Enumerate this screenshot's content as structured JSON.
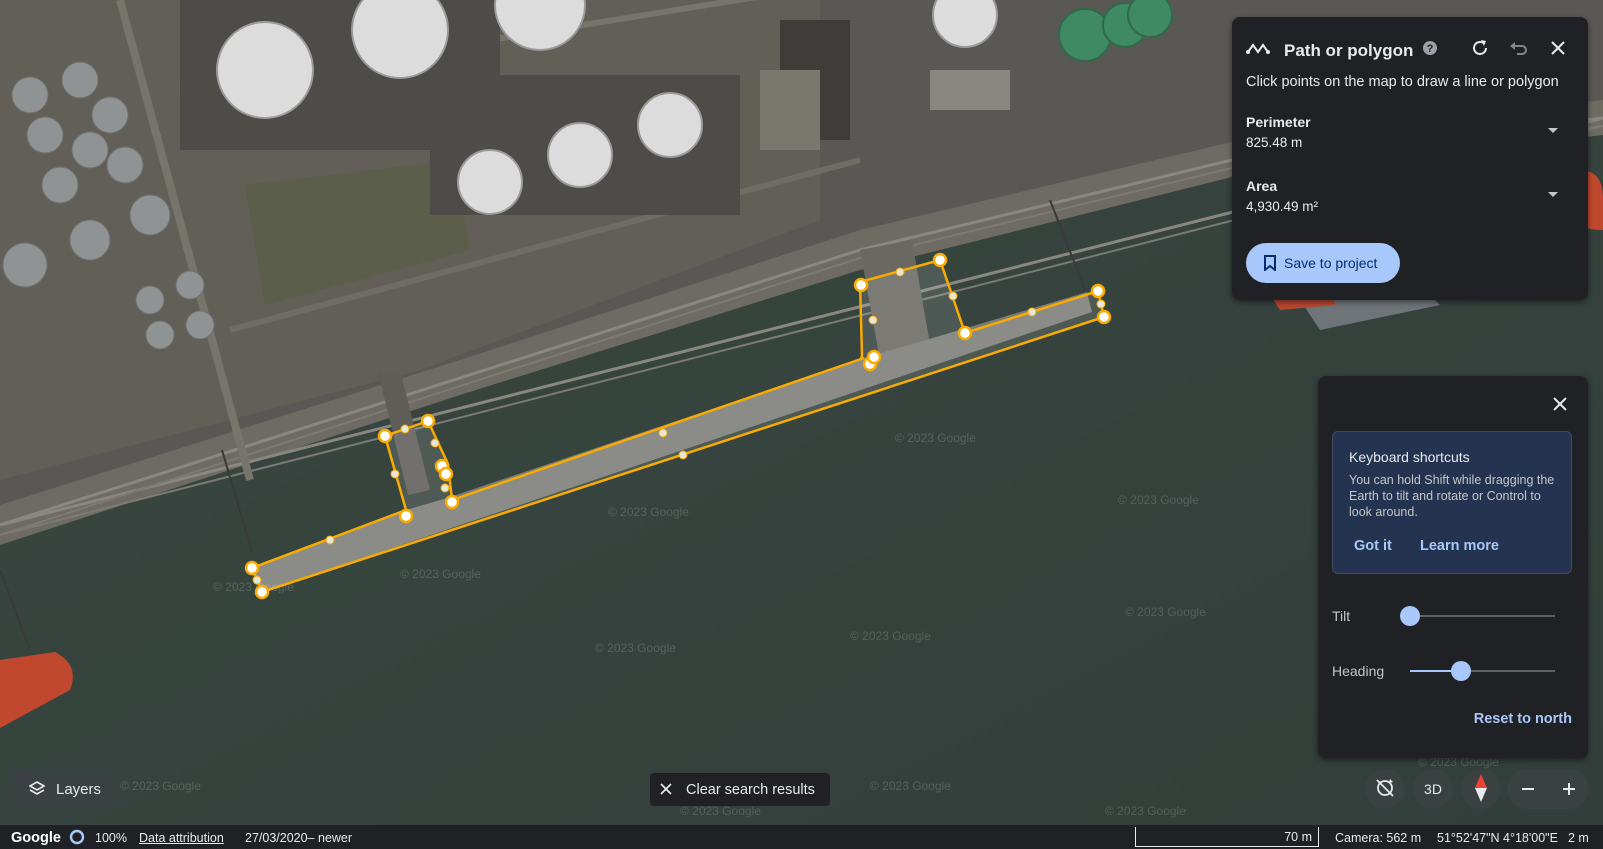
{
  "measure_panel": {
    "title": "Path or polygon",
    "subtitle": "Click points on the map to draw a line or polygon",
    "perimeter_label": "Perimeter",
    "perimeter_value": "825.48 m",
    "area_label": "Area",
    "area_value": "4,930.49 m²",
    "save_label": "Save to project"
  },
  "nav_panel": {
    "shortcuts_title": "Keyboard shortcuts",
    "shortcuts_body": "You can hold Shift while dragging the Earth to tilt and rotate or Control to look around.",
    "got_it": "Got it",
    "learn_more": "Learn more",
    "tilt_label": "Tilt",
    "tilt_value": 0.0,
    "heading_label": "Heading",
    "heading_value": 0.35,
    "reset_label": "Reset to north"
  },
  "controls": {
    "layers_label": "Layers",
    "clear_label": "Clear search results",
    "view_3d_label": "3D"
  },
  "status_bar": {
    "logo": "Google",
    "load_percent": "100%",
    "attribution": "Data attribution",
    "imagery_date": "27/03/2020– newer",
    "scale_label": "70 m",
    "camera": "Camera: 562 m",
    "coords": "51°52'47\"N 4°18'00\"E",
    "elevation": "2 m"
  },
  "map": {
    "watermark": "© 2023 Google"
  },
  "colors": {
    "accent": "#a8c7fa",
    "polygon": "#f9ab00",
    "panel": "#202124"
  }
}
